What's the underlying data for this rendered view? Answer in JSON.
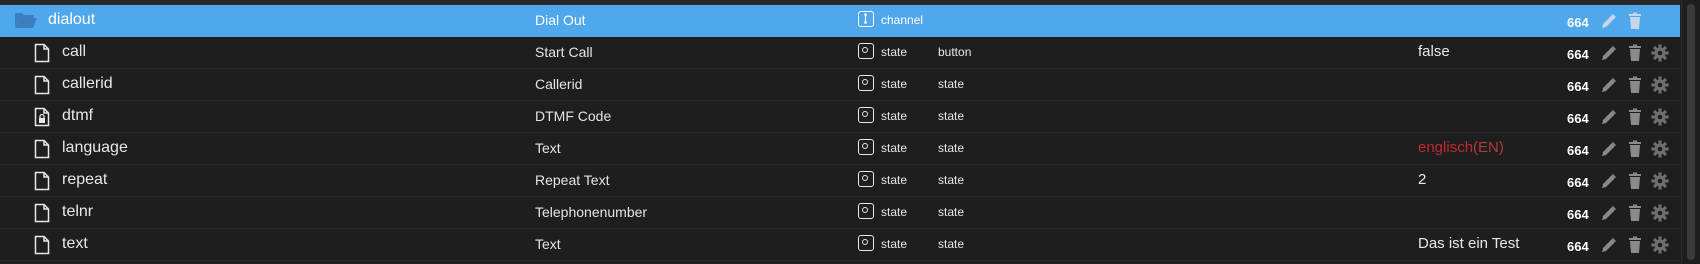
{
  "rows": [
    {
      "name": "dialout",
      "desc": "Dial Out",
      "type": "channel",
      "role": "",
      "value": "",
      "value_suffix": "",
      "perm": "664",
      "icon": "folder-open-icon",
      "selected": true
    },
    {
      "name": "call",
      "desc": "Start Call",
      "type": "state",
      "role": "button",
      "value": "false",
      "value_suffix": "",
      "perm": "664",
      "icon": "file-icon"
    },
    {
      "name": "callerid",
      "desc": "Callerid",
      "type": "state",
      "role": "state",
      "value": "",
      "value_suffix": "",
      "perm": "664",
      "icon": "file-icon"
    },
    {
      "name": "dtmf",
      "desc": "DTMF Code",
      "type": "state",
      "role": "state",
      "value": "",
      "value_suffix": "",
      "perm": "664",
      "icon": "file-lock-icon"
    },
    {
      "name": "language",
      "desc": "Text",
      "type": "state",
      "role": "state",
      "value": "englisch",
      "value_suffix": "(EN)",
      "perm": "664",
      "icon": "file-icon",
      "value_color": "#c2292c"
    },
    {
      "name": "repeat",
      "desc": "Repeat Text",
      "type": "state",
      "role": "state",
      "value": "2",
      "value_suffix": "",
      "perm": "664",
      "icon": "file-icon"
    },
    {
      "name": "telnr",
      "desc": "Telephonenumber",
      "type": "state",
      "role": "state",
      "value": "",
      "value_suffix": "",
      "perm": "664",
      "icon": "file-icon"
    },
    {
      "name": "text",
      "desc": "Text",
      "type": "state",
      "role": "state",
      "value": "Das ist ein Test",
      "value_suffix": "",
      "perm": "664",
      "icon": "file-icon"
    }
  ],
  "colors": {
    "selected_bg": "#4fa7ec",
    "bg": "#1e1e1e",
    "value_red": "#c2292c"
  }
}
